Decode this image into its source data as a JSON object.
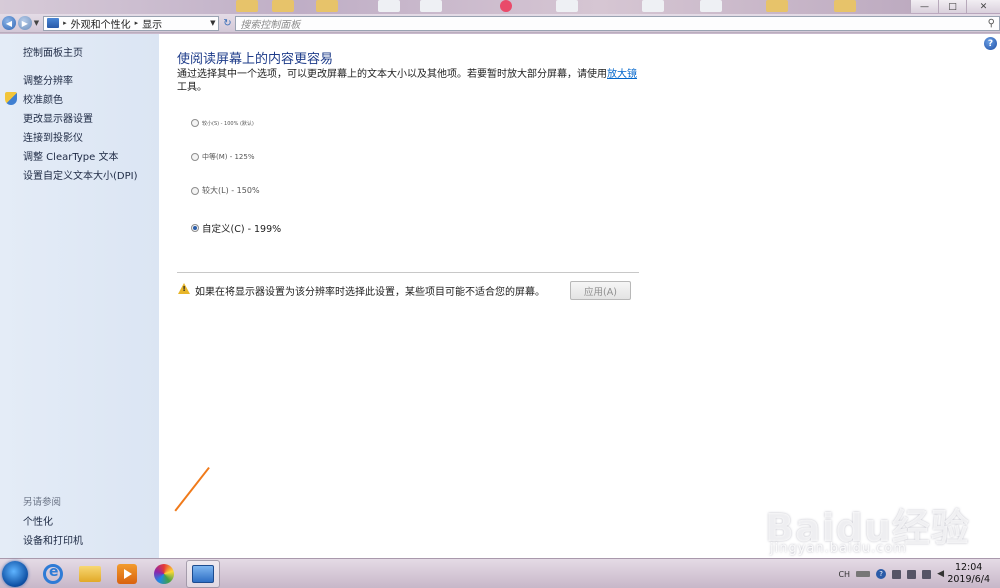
{
  "window": {
    "minimize_symbol": "—",
    "maximize_symbol": "□",
    "close_symbol": "✕"
  },
  "addressbar": {
    "breadcrumb_segments": [
      "外观和个性化",
      "显示"
    ],
    "search_placeholder": "搜索控制面板",
    "back_icon": "back-arrow-icon",
    "forward_icon": "forward-arrow-icon",
    "refresh_icon": "refresh-icon"
  },
  "sidebar": {
    "home_link": "控制面板主页",
    "items": [
      {
        "label": "调整分辨率",
        "icon": null
      },
      {
        "label": "校准颜色",
        "icon": "shield-icon"
      },
      {
        "label": "更改显示器设置",
        "icon": null
      },
      {
        "label": "连接到投影仪",
        "icon": null
      },
      {
        "label": "调整 ClearType 文本",
        "icon": null
      },
      {
        "label": "设置自定义文本大小(DPI)",
        "icon": null
      }
    ],
    "see_also_title": "另请参阅",
    "see_also_items": [
      "个性化",
      "设备和打印机"
    ]
  },
  "main": {
    "title": "使阅读屏幕上的内容更容易",
    "description_prefix": "通过选择其中一个选项，可以更改屏幕上的文本大小以及其他项。若要暂时放大部分屏幕，请使用",
    "description_link": "放大镜",
    "description_suffix": "工具。",
    "options": [
      {
        "label": "较小(S) - 100% (默认)",
        "selected": false
      },
      {
        "label": "中等(M) - 125%",
        "selected": false
      },
      {
        "label": "较大(L) - 150%",
        "selected": false
      },
      {
        "label": "自定义(C) - 199%",
        "selected": true
      }
    ],
    "warning_text": "如果在将显示器设置为该分辨率时选择此设置，某些项目可能不适合您的屏幕。",
    "apply_label": "应用(A)",
    "apply_enabled": false
  },
  "taskbar": {
    "apps": [
      "Internet Explorer",
      "Windows Explorer",
      "Windows Media Player",
      "Color App",
      "Control Panel"
    ],
    "active_app": "Control Panel",
    "tray_lang": "CH",
    "clock_time": "12:04",
    "clock_date": "2019/6/4"
  },
  "watermark": {
    "main": "Baidu经验",
    "sub": "jingyan.baidu.com"
  },
  "colors": {
    "title_blue": "#1e3c8a",
    "link_blue": "#0066cc",
    "sidebar_bg": "#dbe5f3",
    "warning_yellow": "#e8b62a"
  }
}
